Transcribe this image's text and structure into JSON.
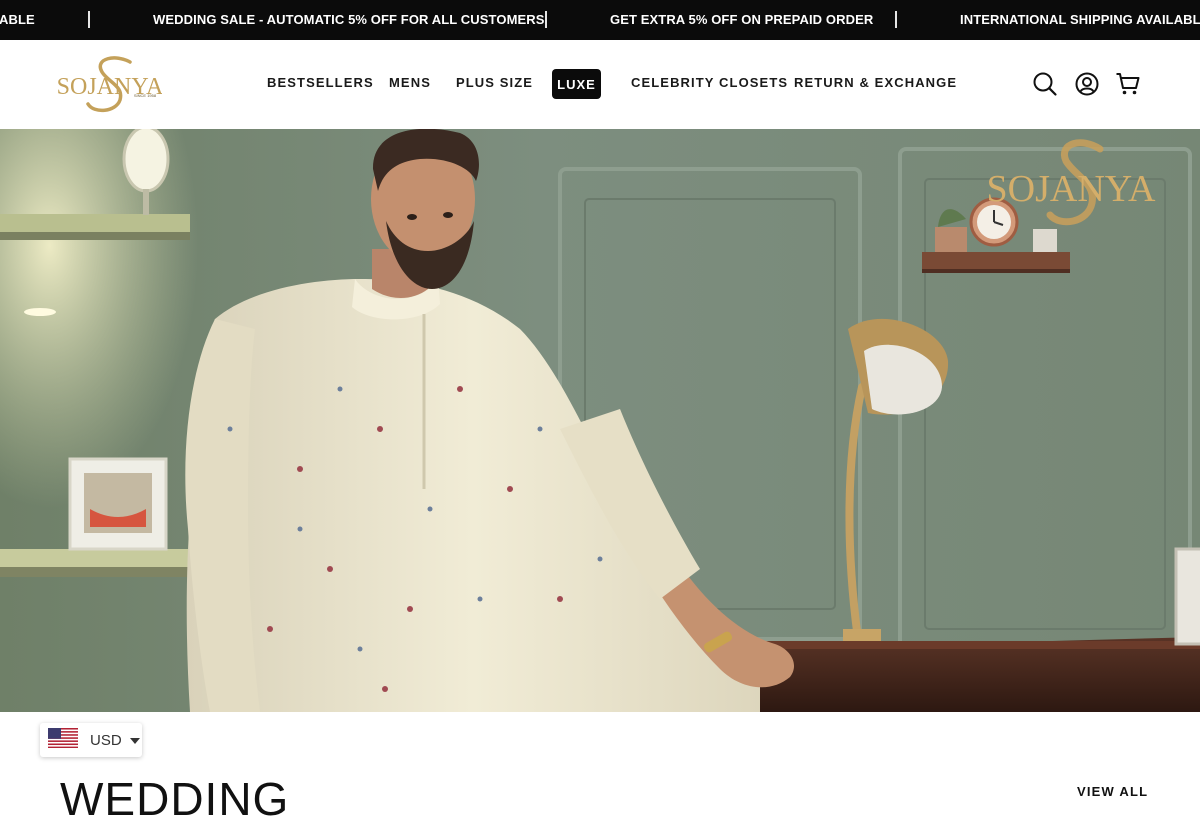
{
  "announcement": {
    "messages": [
      "ABLE",
      "WEDDING SALE - AUTOMATIC 5% OFF FOR ALL CUSTOMERS",
      "GET EXTRA 5% OFF ON PREPAID ORDER",
      "INTERNATIONAL SHIPPING AVAILABLE"
    ]
  },
  "header": {
    "logo_text": "SOJANYA",
    "logo_subtext": "SINCE 1958",
    "nav": [
      "BESTSELLERS",
      "MENS",
      "PLUS SIZE",
      "LUXE",
      "CELEBRITY CLOSETS",
      "RETURN & EXCHANGE"
    ],
    "icons": [
      "search-icon",
      "account-icon",
      "cart-icon"
    ]
  },
  "hero": {
    "watermark_text": "SOJANYA",
    "colors": {
      "wall": "#7e8f80",
      "kurta": "#ece6cf",
      "desk": "#4a2a1e",
      "brass": "#b8955a"
    }
  },
  "currency": {
    "code": "USD",
    "flag": "us-flag-icon"
  },
  "section": {
    "title": "WEDDING",
    "view_all": "VIEW ALL"
  },
  "colors": {
    "announcement_bg": "#0b0b0b",
    "accent_gold": "#c4a15a"
  }
}
